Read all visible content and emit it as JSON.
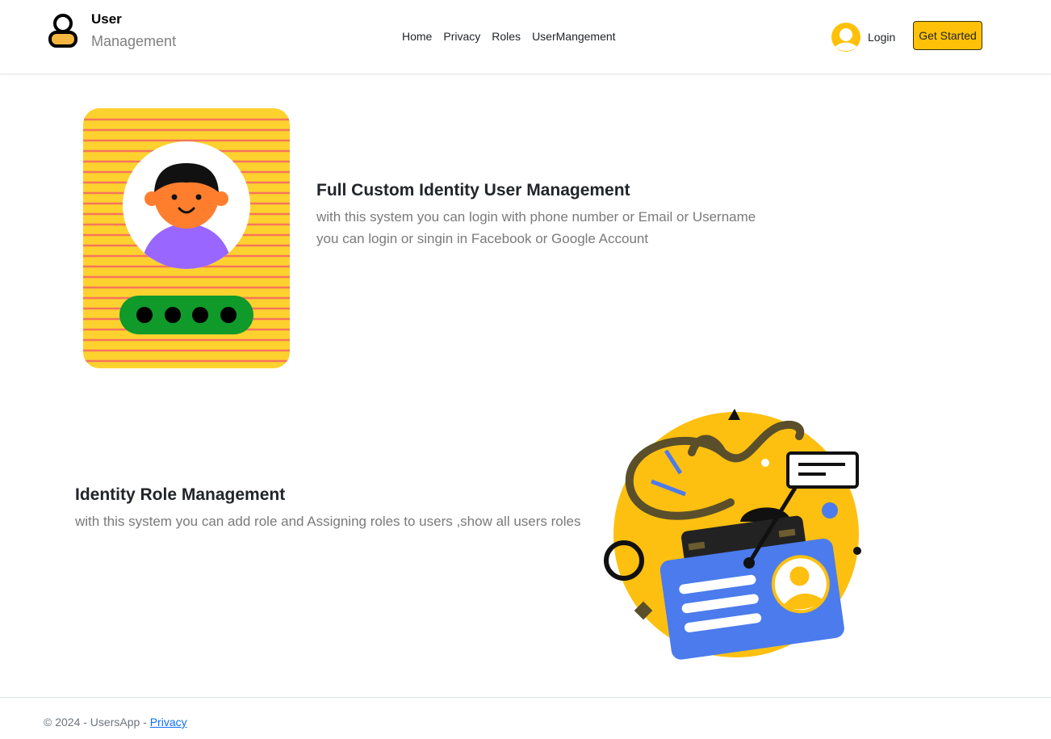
{
  "brand": {
    "title": "User",
    "subtitle": "Management"
  },
  "nav": {
    "items": [
      "Home",
      "Privacy",
      "Roles",
      "UserMangement"
    ]
  },
  "auth": {
    "login_label": "Login",
    "get_started_label": "Get Started"
  },
  "features": [
    {
      "title": "Full Custom Identity User Management",
      "lines": [
        "with this system you can login with phone number or Email or Username",
        "you can login or singin in Facebook or Google Account"
      ]
    },
    {
      "title": "Identity Role Management",
      "lines": [
        "with this system you can add role and Assigning roles to users ,show all users roles"
      ]
    }
  ],
  "footer": {
    "copyright": "© 2024 - UsersApp - ",
    "privacy_link": "Privacy"
  },
  "colors": {
    "accent": "#ffc107",
    "card_blue": "#4b7bec",
    "avatar_purple": "#9966ff",
    "pin_green": "#1a9a2c"
  },
  "icons": [
    "user-logo-icon",
    "user-avatar-icon",
    "login-illustration",
    "id-card-illustration"
  ]
}
